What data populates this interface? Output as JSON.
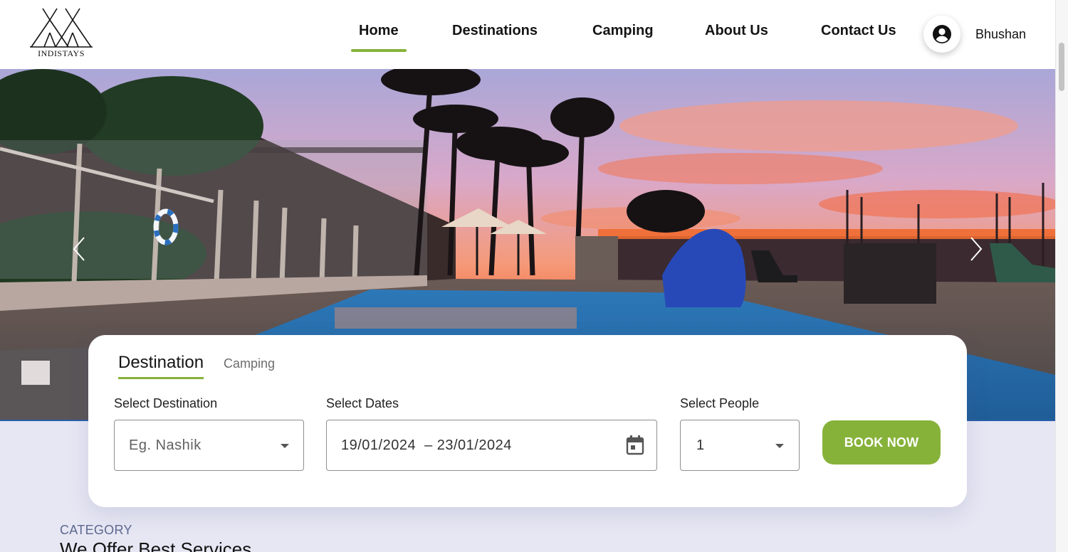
{
  "brand": {
    "name": "INDISTAYS"
  },
  "nav": {
    "items": [
      {
        "label": "Home",
        "active": true
      },
      {
        "label": "Destinations",
        "active": false
      },
      {
        "label": "Camping",
        "active": false
      },
      {
        "label": "About Us",
        "active": false
      },
      {
        "label": "Contact Us",
        "active": false
      }
    ]
  },
  "user": {
    "name": "Bhushan",
    "icon": "account-circle-icon"
  },
  "hero": {
    "image": "sunset-pool-palm-trees-photo",
    "prev_icon": "chevron-left-icon",
    "next_icon": "chevron-right-icon"
  },
  "search": {
    "tabs": [
      {
        "label": "Destination",
        "active": true
      },
      {
        "label": "Camping",
        "active": false
      }
    ],
    "destination": {
      "label": "Select Destination",
      "placeholder": "Eg. Nashik"
    },
    "dates": {
      "label": "Select Dates",
      "start": "19/01/2024",
      "separator": "–",
      "end": "23/01/2024",
      "icon": "calendar-icon"
    },
    "people": {
      "label": "Select People",
      "value": "1"
    },
    "book_label": "BOOK NOW"
  },
  "category": {
    "label": "CATEGORY",
    "title": "We Offer Best Services"
  },
  "colors": {
    "accent": "#86b23a",
    "page_bg": "#e6e7f3",
    "card_bg": "#ffffff"
  }
}
